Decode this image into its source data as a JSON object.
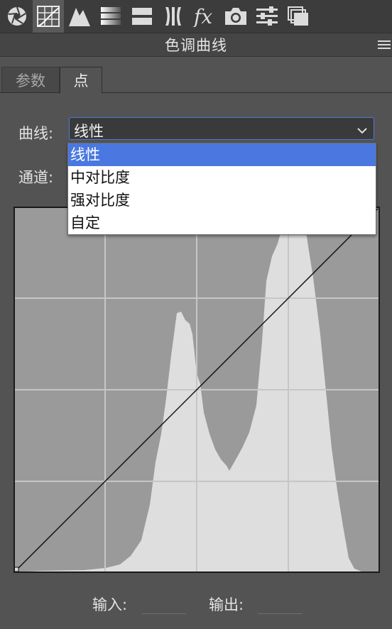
{
  "toolbar": {
    "icons": [
      "aperture-icon",
      "curves-grid-icon",
      "mountains-icon",
      "gradient-bars-icon",
      "split-bars-icon",
      "lens-icon",
      "fx-icon",
      "camera-icon",
      "sliders-icon",
      "layers-icon"
    ],
    "active": "curves-grid-icon"
  },
  "panel": {
    "title": "色调曲线"
  },
  "tabs": [
    {
      "label": "参数",
      "active": false
    },
    {
      "label": "点",
      "active": true
    }
  ],
  "curve": {
    "label": "曲线:",
    "value": "线性",
    "options": [
      "线性",
      "中对比度",
      "强对比度",
      "自定"
    ]
  },
  "channel": {
    "label": "通道:"
  },
  "io": {
    "input_label": "输入:",
    "output_label": "输出:"
  },
  "colors": {
    "graph_bg": "#9a9a9a",
    "histogram": "#dedede",
    "grid": "#c6c6c6",
    "accent": "#4a78e0"
  }
}
